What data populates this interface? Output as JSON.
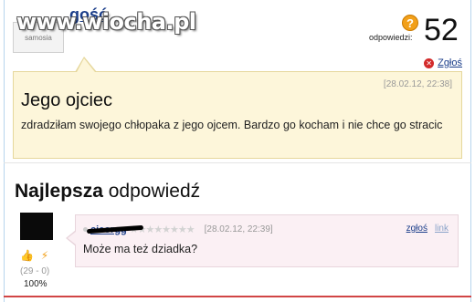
{
  "watermark": "www.wiocha.pl",
  "user": {
    "name": "gość",
    "avatar_label": "samosia"
  },
  "question": {
    "answers_icon": "?",
    "answers_label": "odpowiedzi:",
    "answers_count": "52",
    "report_label": "Zgłoś",
    "date": "[28.02.12, 22:38]",
    "title": "Jego ojciec",
    "body": "zdradziłam swojego chłopaka z jego ojcem. Bardzo go kocham i nie chce go stracic"
  },
  "best_answer": {
    "heading_bold": "Najlepsza",
    "heading_rest": " odpowiedź",
    "username": "cieorgg",
    "stars": "★★★★★★★★",
    "date": "[28.02.12, 22:39]",
    "report_label": "zgłoś",
    "link_label": "link",
    "text": "Może ma też dziadka?",
    "votes": "(29 - 0)",
    "percent": "100%"
  },
  "colors": {
    "link": "#1b3e8a",
    "question_bg": "#fdf6da",
    "answer_bg": "#fbf0f4",
    "accent_orange": "#f2a01a"
  }
}
